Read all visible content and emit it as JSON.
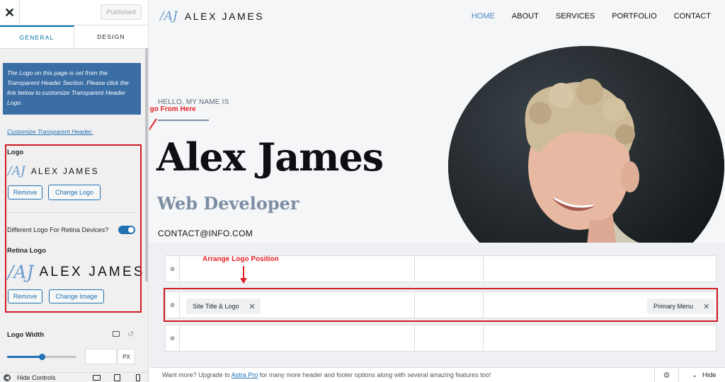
{
  "sidebar": {
    "close_icon": "close-icon",
    "published_label": "Published",
    "tabs": [
      {
        "label": "GENERAL"
      },
      {
        "label": "DESIGN"
      }
    ],
    "notice": "The Logo on this page is set from the Transparent Header Section. Please click the link below to customize Transparent Header Logo.",
    "customize_link": "Customize Transparent Header.",
    "logo_label": "Logo",
    "logo_mark": "/AJ",
    "logo_text": "ALEX JAMES",
    "remove_label": "Remove",
    "change_logo_label": "Change Logo",
    "retina_toggle_label": "Different Logo For Retina Devices?",
    "retina_toggle_on": true,
    "retina_logo_label": "Retina Logo",
    "change_image_label": "Change Image",
    "logo_width_label": "Logo Width",
    "logo_width_slider_fraction": 0.5,
    "unit_label": "PX",
    "hide_controls_label": "Hide Controls"
  },
  "annotations": {
    "change_logo": "Change Logo From Here",
    "arrange_logo": "Arrange Logo Position",
    "highlight_color": "#d01b24"
  },
  "preview": {
    "site_logo_mark": "/AJ",
    "site_logo_text": "ALEX JAMES",
    "menu": [
      {
        "label": "HOME",
        "active": true
      },
      {
        "label": "ABOUT"
      },
      {
        "label": "SERVICES"
      },
      {
        "label": "PORTFOLIO"
      },
      {
        "label": "CONTACT"
      }
    ],
    "hello": "HELLO, MY NAME IS",
    "name": "Alex James",
    "role": "Web Developer",
    "contact": "CONTACT@INFO.COM",
    "accent_color": "#4d88c4"
  },
  "builder": {
    "chip_site_title": "Site Title & Logo",
    "chip_primary_menu": "Primary Menu"
  },
  "footer": {
    "msg_before": "Want more? Upgrade to ",
    "msg_link": "Astra Pro",
    "msg_after": " for many more header and footer options along with several amazing features too!",
    "hide_label": "Hide"
  }
}
